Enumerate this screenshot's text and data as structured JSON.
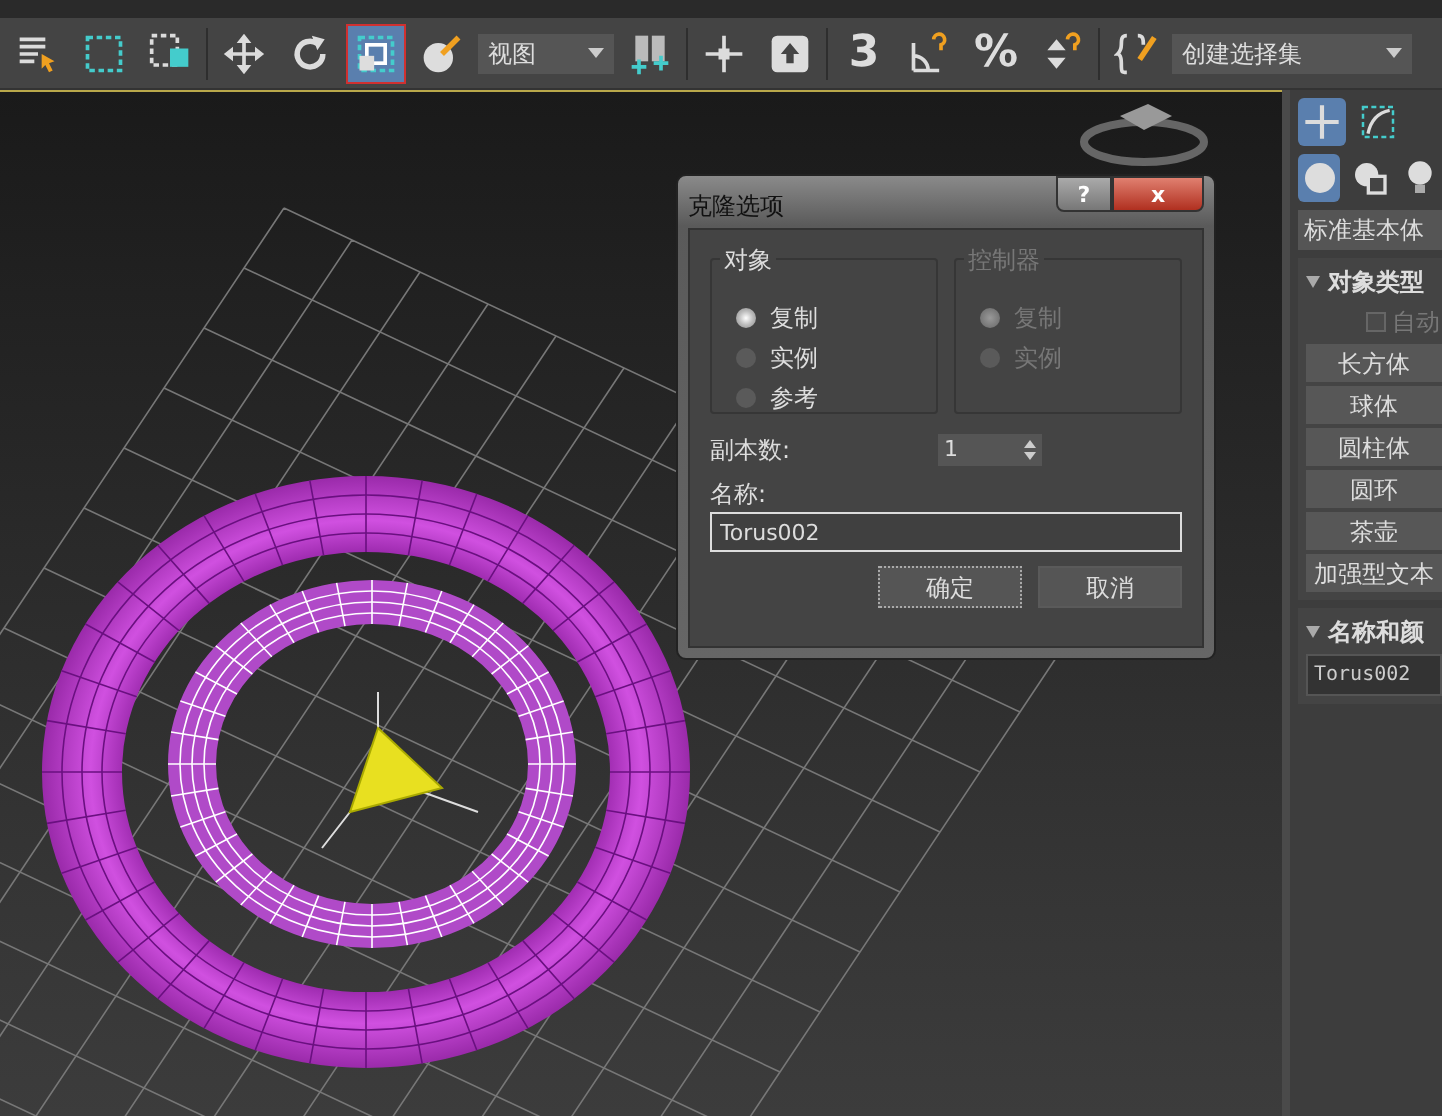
{
  "toolbar": {
    "items": [
      {
        "kind": "tool",
        "selected": false
      },
      {
        "kind": "tool",
        "selected": false
      },
      {
        "kind": "tool",
        "selected": false
      },
      {
        "kind": "separator"
      },
      {
        "kind": "tool",
        "selected": false
      },
      {
        "kind": "tool",
        "selected": false
      },
      {
        "kind": "tool",
        "selected": true
      },
      {
        "kind": "tool",
        "selected": false
      },
      {
        "kind": "dropdown",
        "value": "视图"
      },
      {
        "kind": "tool",
        "selected": false
      },
      {
        "kind": "separator"
      },
      {
        "kind": "tool",
        "selected": false
      },
      {
        "kind": "tool",
        "selected": false
      },
      {
        "kind": "separator"
      },
      {
        "kind": "glyph",
        "glyph": "3",
        "selected": false
      },
      {
        "kind": "tool",
        "selected": false
      },
      {
        "kind": "glyph",
        "glyph": "%",
        "selected": false
      },
      {
        "kind": "tool",
        "selected": false
      },
      {
        "kind": "separator"
      },
      {
        "kind": "tool",
        "selected": false
      },
      {
        "kind": "dropdown",
        "value": "创建选择集"
      }
    ]
  },
  "dialog": {
    "title": "克隆选项",
    "help": "?",
    "close": "x",
    "groups": [
      {
        "title": "对象",
        "disabled": false,
        "options": [
          {
            "label": "复制",
            "selected": true
          },
          {
            "label": "实例",
            "selected": false
          },
          {
            "label": "参考",
            "selected": false
          }
        ]
      },
      {
        "title": "控制器",
        "disabled": true,
        "options": [
          {
            "label": "复制",
            "selected": true
          },
          {
            "label": "实例",
            "selected": false
          }
        ]
      }
    ],
    "copies_label": "副本数:",
    "copies_value": "1",
    "name_label": "名称:",
    "name_value": "Torus002",
    "buttons": [
      {
        "label": "确定",
        "focused": true
      },
      {
        "label": "取消",
        "focused": false
      }
    ]
  },
  "command_panel": {
    "tabs": [
      {
        "selected": true
      },
      {
        "selected": false
      }
    ],
    "categories": [
      {
        "selected": true
      },
      {
        "selected": false
      },
      {
        "selected": false
      }
    ],
    "type_dropdown": "标准基本体",
    "rollouts": [
      {
        "title": "对象类型",
        "expanded": true,
        "checkbox": {
          "label": "自动",
          "checked": false,
          "disabled": true
        },
        "buttons": [
          "长方体",
          "球体",
          "圆柱体",
          "圆环",
          "茶壶",
          "加强型文本"
        ]
      },
      {
        "title": "名称和颜",
        "expanded": true,
        "name_value": "Torus002"
      }
    ]
  }
}
